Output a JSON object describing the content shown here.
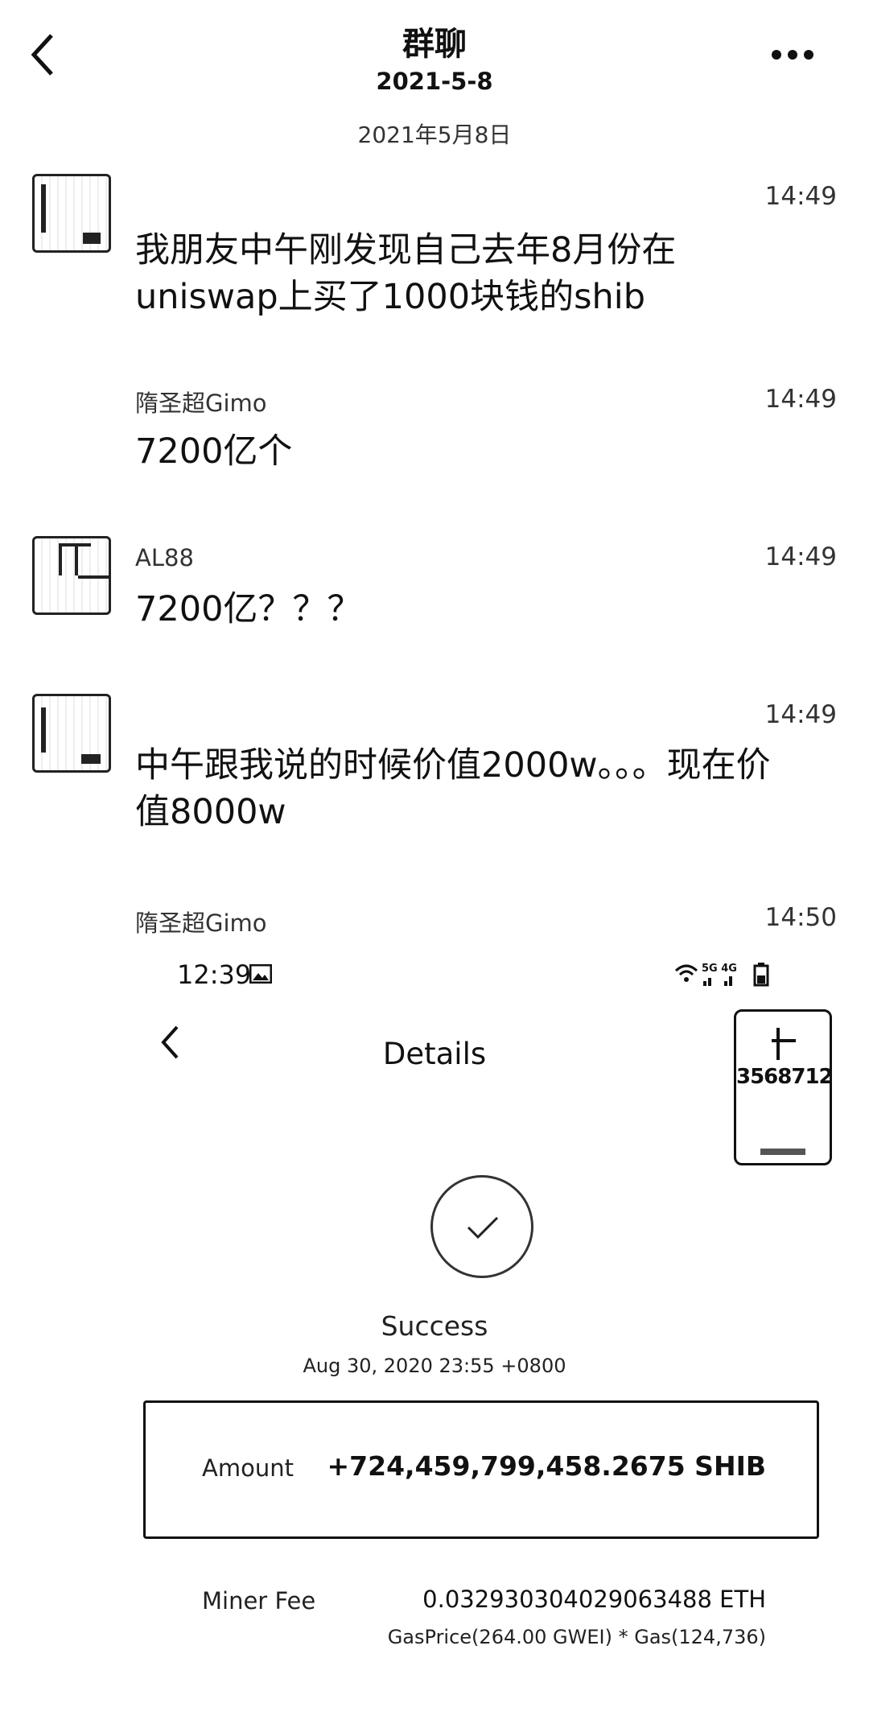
{
  "header": {
    "title": "群聊",
    "subtitle": "2021-5-8",
    "back_icon": "back-chevron-icon",
    "more_icon": "more-dots-icon"
  },
  "date_separator": "2021年5月8日",
  "messages": [
    {
      "sender": "",
      "time": "14:49",
      "lines": [
        "我朋友中午刚发现自己去年8月份在",
        "uniswap上买了1000块钱的shib"
      ]
    },
    {
      "sender": "隋圣超Gimo",
      "time": "14:49",
      "lines": [
        "7200亿个"
      ]
    },
    {
      "sender": "AL88",
      "time": "14:49",
      "lines": [
        "7200亿？？？"
      ]
    },
    {
      "sender": "",
      "time": "14:49",
      "lines": [
        "中午跟我说的时候价值2000w。。。现在价",
        "值8000w"
      ]
    },
    {
      "sender": "隋圣超Gimo",
      "time": "14:50",
      "lines": []
    }
  ],
  "screenshot": {
    "status_time": "12:39",
    "status_icons": "5G 4G",
    "title": "Details",
    "thumb_number": "3568712",
    "status": "Success",
    "date": "Aug 30, 2020 23:55 +0800",
    "amount_label": "Amount",
    "amount_value": "+724,459,799,458.2675 SHIB",
    "fee_label": "Miner Fee",
    "fee_value": "0.032930304029063488 ETH",
    "fee_detail": "GasPrice(264.00 GWEI) * Gas(124,736)"
  }
}
